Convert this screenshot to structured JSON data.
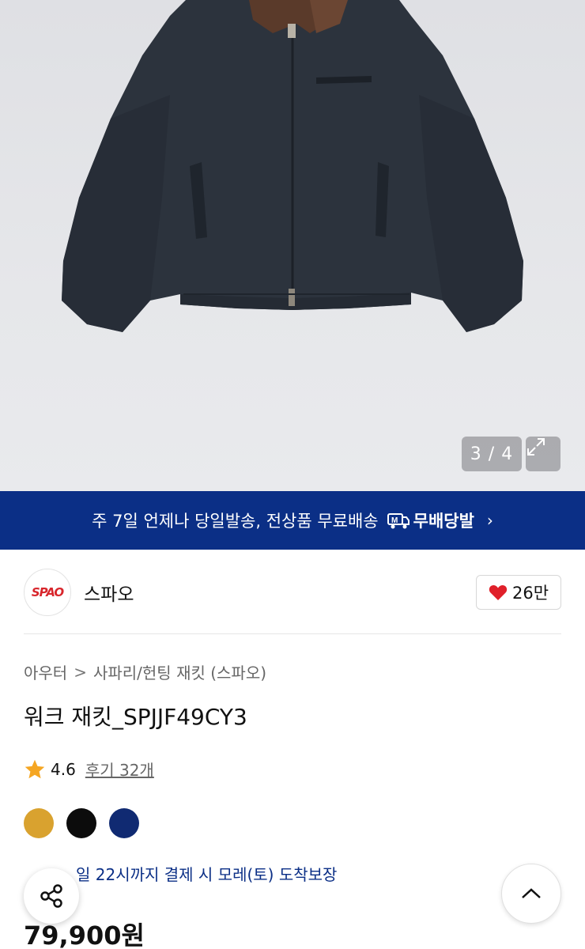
{
  "gallery": {
    "counter": "3 / 4",
    "expand_icon": "expand-icon"
  },
  "banner": {
    "text": "주 7일 언제나 당일발송, 전상품 무료배송",
    "brand_label": "무배당발",
    "icon": "truck-icon",
    "chevron": "›",
    "color": "#0b2f86"
  },
  "brand": {
    "logo_text": "SPAO",
    "name": "스파오",
    "likes": "26만",
    "heart_color": "#e0202a"
  },
  "breadcrumb": {
    "category": "아우터",
    "separator": ">",
    "subcategory": "사파리/헌팅 재킷 (스파오)"
  },
  "product": {
    "title": "워크 재킷_SPJJF49CY3",
    "rating": "4.6",
    "reviews": "후기 32개",
    "price": "79,900원",
    "colors": [
      "#d9a22f",
      "#0c0c0c",
      "#102a72"
    ],
    "delivery": "일 22시까지 결제 시 모레(토) 도착보장"
  },
  "floating": {
    "share_icon": "share-icon",
    "top_icon": "chevron-up-icon"
  }
}
